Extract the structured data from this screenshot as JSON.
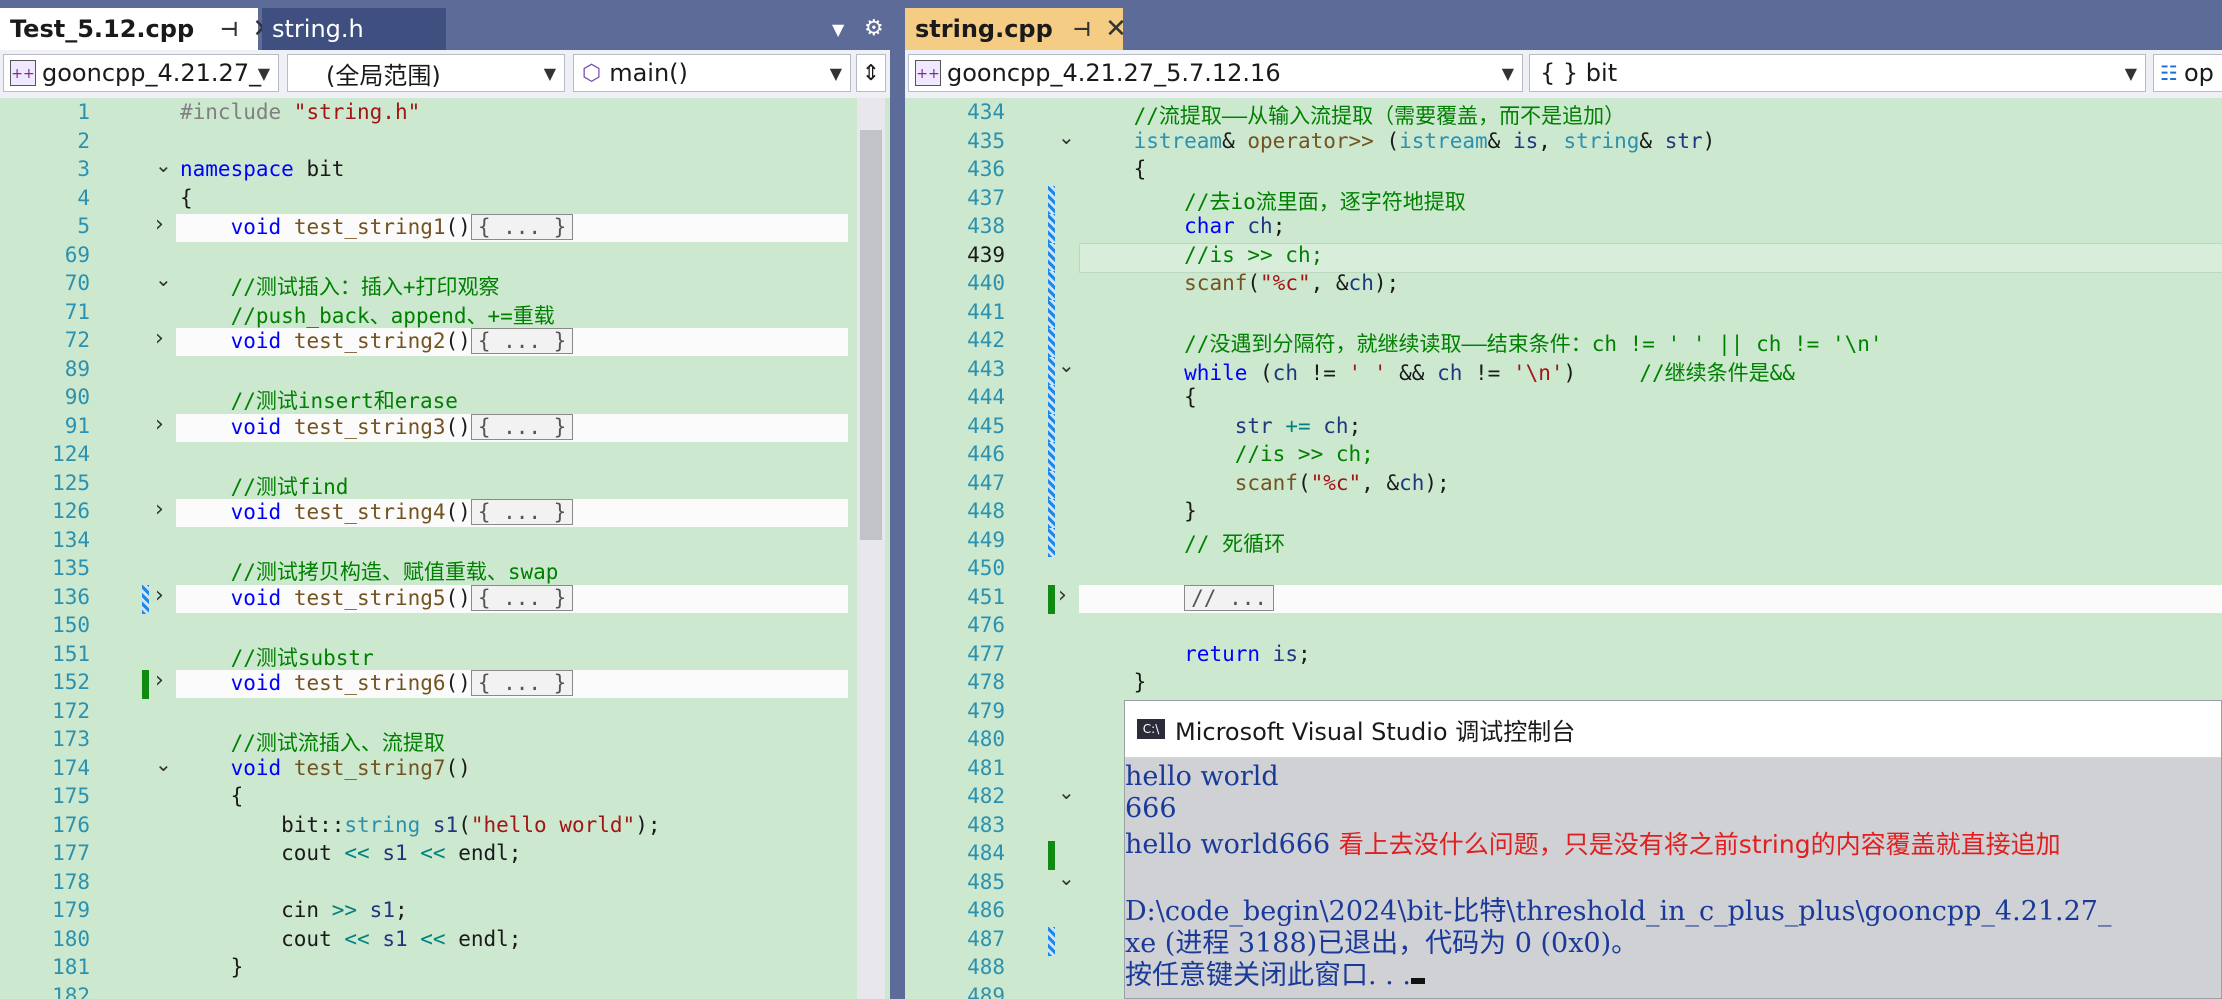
{
  "left": {
    "tabs": [
      {
        "label": "Test_5.12.cpp",
        "active": true
      },
      {
        "label": "string.h",
        "active": false
      }
    ],
    "nav": {
      "project": "gooncpp_4.21.27_",
      "scope": "(全局范围)",
      "member": "main()"
    },
    "lines": [
      {
        "n": "1",
        "parts": [
          [
            "pp",
            "#include "
          ],
          [
            "st",
            "\"string.h\""
          ]
        ]
      },
      {
        "n": "2",
        "parts": []
      },
      {
        "n": "3",
        "fold": "open",
        "parts": [
          [
            "kw",
            "namespace"
          ],
          [
            "",
            " bit"
          ]
        ]
      },
      {
        "n": "4",
        "parts": [
          [
            "",
            "{"
          ]
        ]
      },
      {
        "n": "5",
        "fold": "closed",
        "hl": true,
        "parts": [
          [
            "",
            "    "
          ],
          [
            "kw",
            "void"
          ],
          [
            "",
            " "
          ],
          [
            "fn",
            "test_string1"
          ],
          [
            "",
            "()"
          ]
        ],
        "coll": "{ ... }"
      },
      {
        "n": "69",
        "parts": []
      },
      {
        "n": "70",
        "fold": "open",
        "parts": [
          [
            "",
            "    "
          ],
          [
            "cm",
            "//测试插入：插入+打印观察"
          ]
        ]
      },
      {
        "n": "71",
        "parts": [
          [
            "",
            "    "
          ],
          [
            "cm",
            "//push_back、append、+=重载"
          ]
        ]
      },
      {
        "n": "72",
        "fold": "closed",
        "hl": true,
        "parts": [
          [
            "",
            "    "
          ],
          [
            "kw",
            "void"
          ],
          [
            "",
            " "
          ],
          [
            "fn",
            "test_string2"
          ],
          [
            "",
            "()"
          ]
        ],
        "coll": "{ ... }"
      },
      {
        "n": "89",
        "parts": []
      },
      {
        "n": "90",
        "parts": [
          [
            "",
            "    "
          ],
          [
            "cm",
            "//测试insert和erase"
          ]
        ]
      },
      {
        "n": "91",
        "fold": "closed",
        "hl": true,
        "parts": [
          [
            "",
            "    "
          ],
          [
            "kw",
            "void"
          ],
          [
            "",
            " "
          ],
          [
            "fn",
            "test_string3"
          ],
          [
            "",
            "()"
          ]
        ],
        "coll": "{ ... }"
      },
      {
        "n": "124",
        "parts": []
      },
      {
        "n": "125",
        "parts": [
          [
            "",
            "    "
          ],
          [
            "cm",
            "//测试find"
          ]
        ]
      },
      {
        "n": "126",
        "fold": "closed",
        "hl": true,
        "parts": [
          [
            "",
            "    "
          ],
          [
            "kw",
            "void"
          ],
          [
            "",
            " "
          ],
          [
            "fn",
            "test_string4"
          ],
          [
            "",
            "()"
          ]
        ],
        "coll": "{ ... }"
      },
      {
        "n": "134",
        "parts": []
      },
      {
        "n": "135",
        "parts": [
          [
            "",
            "    "
          ],
          [
            "cm",
            "//测试拷贝构造、赋值重载、swap"
          ]
        ]
      },
      {
        "n": "136",
        "fold": "closed",
        "hl": true,
        "chg": "b",
        "parts": [
          [
            "",
            "    "
          ],
          [
            "kw",
            "void"
          ],
          [
            "",
            " "
          ],
          [
            "fn",
            "test_string5"
          ],
          [
            "",
            "()"
          ]
        ],
        "coll": "{ ... }"
      },
      {
        "n": "150",
        "parts": []
      },
      {
        "n": "151",
        "parts": [
          [
            "",
            "    "
          ],
          [
            "cm",
            "//测试substr"
          ]
        ]
      },
      {
        "n": "152",
        "fold": "closed",
        "hl": true,
        "chg": "g",
        "parts": [
          [
            "",
            "    "
          ],
          [
            "kw",
            "void"
          ],
          [
            "",
            " "
          ],
          [
            "fn",
            "test_string6"
          ],
          [
            "",
            "()"
          ]
        ],
        "coll": "{ ... }"
      },
      {
        "n": "172",
        "parts": []
      },
      {
        "n": "173",
        "parts": [
          [
            "",
            "    "
          ],
          [
            "cm",
            "//测试流插入、流提取"
          ]
        ]
      },
      {
        "n": "174",
        "fold": "open",
        "parts": [
          [
            "",
            "    "
          ],
          [
            "kw",
            "void"
          ],
          [
            "",
            " "
          ],
          [
            "fn",
            "test_string7"
          ],
          [
            "",
            "()"
          ]
        ]
      },
      {
        "n": "175",
        "parts": [
          [
            "",
            "    {"
          ]
        ]
      },
      {
        "n": "176",
        "parts": [
          [
            "",
            "        bit::"
          ],
          [
            "ty",
            "string"
          ],
          [
            "",
            " "
          ],
          [
            "vr",
            "s1"
          ],
          [
            "",
            "("
          ],
          [
            "st",
            "\"hello world\""
          ],
          [
            "",
            ");"
          ]
        ]
      },
      {
        "n": "177",
        "parts": [
          [
            "",
            "        cout "
          ],
          [
            "op",
            "<<"
          ],
          [
            "",
            " "
          ],
          [
            "vr",
            "s1"
          ],
          [
            "",
            " "
          ],
          [
            "op",
            "<<"
          ],
          [
            "",
            " endl;"
          ]
        ]
      },
      {
        "n": "178",
        "parts": []
      },
      {
        "n": "179",
        "parts": [
          [
            "",
            "        cin "
          ],
          [
            "op",
            ">>"
          ],
          [
            "",
            " "
          ],
          [
            "vr",
            "s1"
          ],
          [
            "",
            ";"
          ]
        ]
      },
      {
        "n": "180",
        "parts": [
          [
            "",
            "        cout "
          ],
          [
            "op",
            "<<"
          ],
          [
            "",
            " "
          ],
          [
            "vr",
            "s1"
          ],
          [
            "",
            " "
          ],
          [
            "op",
            "<<"
          ],
          [
            "",
            " endl;"
          ]
        ]
      },
      {
        "n": "181",
        "parts": [
          [
            "",
            "    }"
          ]
        ]
      },
      {
        "n": "182",
        "parts": []
      }
    ]
  },
  "right": {
    "tabs": [
      {
        "label": "string.cpp",
        "active": true
      }
    ],
    "nav": {
      "project": "gooncpp_4.21.27_5.7.12.16",
      "scope": "{ } bit",
      "member": "op"
    },
    "lines": [
      {
        "n": "434",
        "parts": [
          [
            "",
            "    "
          ],
          [
            "cm",
            "//流提取——从输入流提取（需要覆盖，而不是追加）"
          ]
        ]
      },
      {
        "n": "435",
        "fold": "open",
        "parts": [
          [
            "",
            "    "
          ],
          [
            "ty",
            "istream"
          ],
          [
            "",
            "& "
          ],
          [
            "fn",
            "operator>>"
          ],
          [
            "",
            " ("
          ],
          [
            "ty",
            "istream"
          ],
          [
            "",
            "& "
          ],
          [
            "vr",
            "is"
          ],
          [
            "",
            ", "
          ],
          [
            "ty",
            "string"
          ],
          [
            "",
            "& "
          ],
          [
            "vr",
            "str"
          ],
          [
            "",
            ")"
          ]
        ]
      },
      {
        "n": "436",
        "parts": [
          [
            "",
            "    {"
          ]
        ]
      },
      {
        "n": "437",
        "chg": "b",
        "parts": [
          [
            "",
            "        "
          ],
          [
            "cm",
            "//去io流里面，逐字符地提取"
          ]
        ]
      },
      {
        "n": "438",
        "chg": "b",
        "parts": [
          [
            "",
            "        "
          ],
          [
            "kw",
            "char"
          ],
          [
            "",
            " "
          ],
          [
            "vr",
            "ch"
          ],
          [
            "",
            ";"
          ]
        ]
      },
      {
        "n": "439",
        "chg": "b",
        "current": true,
        "parts": [
          [
            "",
            "        "
          ],
          [
            "cm",
            "//is >> ch;"
          ]
        ]
      },
      {
        "n": "440",
        "chg": "b",
        "parts": [
          [
            "",
            "        "
          ],
          [
            "fn",
            "scanf"
          ],
          [
            "",
            "("
          ],
          [
            "st",
            "\"%c\""
          ],
          [
            "",
            ", &"
          ],
          [
            "vr",
            "ch"
          ],
          [
            "",
            ");"
          ]
        ]
      },
      {
        "n": "441",
        "chg": "b",
        "parts": []
      },
      {
        "n": "442",
        "chg": "b",
        "parts": [
          [
            "",
            "        "
          ],
          [
            "cm",
            "//没遇到分隔符，就继续读取——结束条件：ch != ' ' || ch != '\\n'"
          ]
        ]
      },
      {
        "n": "443",
        "chg": "b",
        "fold": "open",
        "parts": [
          [
            "",
            "        "
          ],
          [
            "kw",
            "while"
          ],
          [
            "",
            " ("
          ],
          [
            "vr",
            "ch"
          ],
          [
            "",
            " != "
          ],
          [
            "st",
            "' '"
          ],
          [
            "",
            " && "
          ],
          [
            "vr",
            "ch"
          ],
          [
            "",
            " != "
          ],
          [
            "st",
            "'\\n'"
          ],
          [
            "",
            ")     "
          ],
          [
            "cm",
            "//继续条件是&&"
          ]
        ]
      },
      {
        "n": "444",
        "chg": "b",
        "parts": [
          [
            "",
            "        {"
          ]
        ]
      },
      {
        "n": "445",
        "chg": "b",
        "parts": [
          [
            "",
            "            "
          ],
          [
            "vr",
            "str"
          ],
          [
            "",
            " "
          ],
          [
            "op",
            "+="
          ],
          [
            "",
            " "
          ],
          [
            "vr",
            "ch"
          ],
          [
            "",
            ";"
          ]
        ]
      },
      {
        "n": "446",
        "chg": "b",
        "parts": [
          [
            "",
            "            "
          ],
          [
            "cm",
            "//is >> ch;"
          ]
        ]
      },
      {
        "n": "447",
        "chg": "b",
        "parts": [
          [
            "",
            "            "
          ],
          [
            "fn",
            "scanf"
          ],
          [
            "",
            "("
          ],
          [
            "st",
            "\"%c\""
          ],
          [
            "",
            ", &"
          ],
          [
            "vr",
            "ch"
          ],
          [
            "",
            ");"
          ]
        ]
      },
      {
        "n": "448",
        "chg": "b",
        "parts": [
          [
            "",
            "        }"
          ]
        ]
      },
      {
        "n": "449",
        "chg": "b",
        "parts": [
          [
            "",
            "        "
          ],
          [
            "cm",
            "// 死循环"
          ]
        ]
      },
      {
        "n": "450",
        "parts": []
      },
      {
        "n": "451",
        "fold": "closed",
        "hl": true,
        "chg": "g",
        "parts": [
          [
            "",
            "        "
          ]
        ],
        "coll": "// ..."
      },
      {
        "n": "476",
        "parts": []
      },
      {
        "n": "477",
        "parts": [
          [
            "",
            "        "
          ],
          [
            "kw",
            "return"
          ],
          [
            "",
            " "
          ],
          [
            "vr",
            "is"
          ],
          [
            "",
            ";"
          ]
        ]
      },
      {
        "n": "478",
        "parts": [
          [
            "",
            "    }"
          ]
        ]
      },
      {
        "n": "479",
        "parts": []
      },
      {
        "n": "480",
        "parts": []
      },
      {
        "n": "481",
        "parts": []
      },
      {
        "n": "482",
        "fold": "open",
        "parts": []
      },
      {
        "n": "483",
        "parts": []
      },
      {
        "n": "484",
        "chg": "g",
        "parts": []
      },
      {
        "n": "485",
        "fold": "open",
        "parts": []
      },
      {
        "n": "486",
        "parts": []
      },
      {
        "n": "487",
        "chg": "b",
        "parts": []
      },
      {
        "n": "488",
        "parts": []
      },
      {
        "n": "489",
        "parts": []
      }
    ]
  },
  "console": {
    "title": "Microsoft Visual Studio 调试控制台",
    "lines": [
      "hello world",
      "666",
      "hello world666",
      "",
      "D:\\code_begin\\2024\\bit-比特\\threshold_in_c_plus_plus\\gooncpp_4.21.27_",
      "xe (进程 3188)已退出，代码为 0 (0x0)。",
      "按任意键关闭此窗口. . ."
    ],
    "annotation": "看上去没什么问题，只是没有将之前string的内容覆盖就直接追加"
  }
}
